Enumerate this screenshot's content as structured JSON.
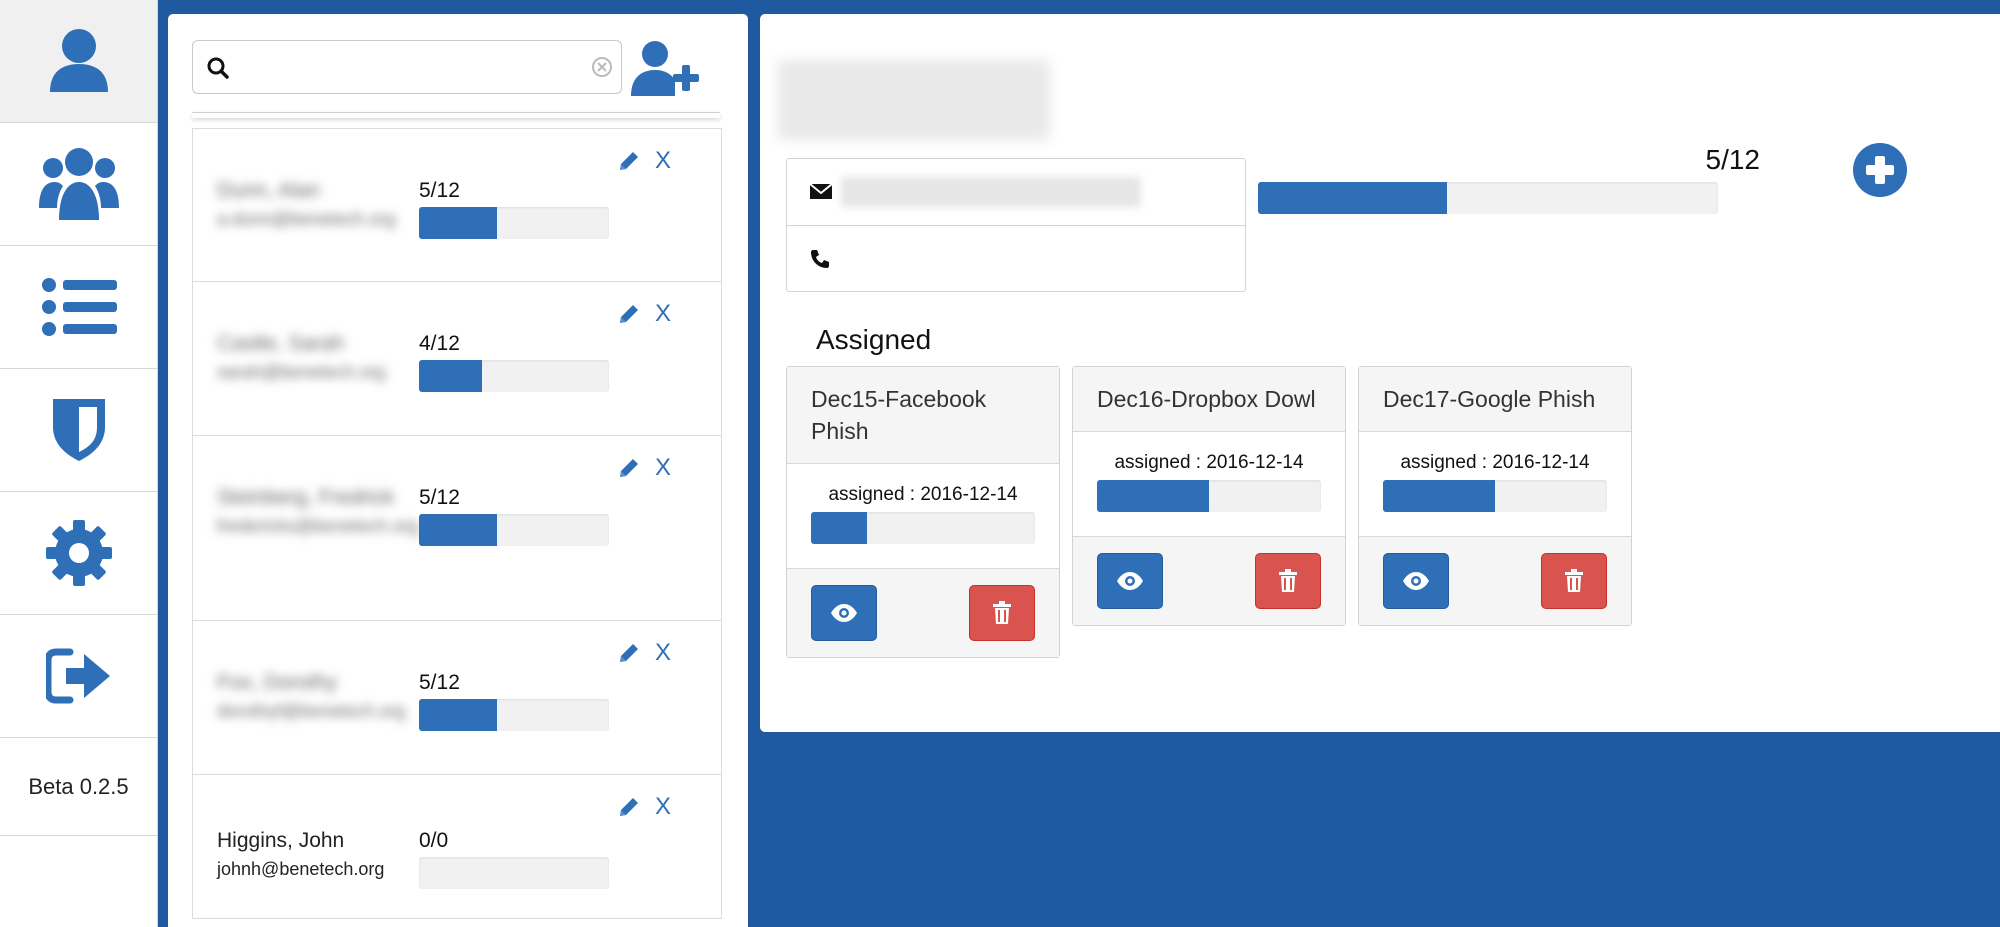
{
  "sidebar": {
    "items": [
      {
        "name": "user",
        "icon": "user-icon"
      },
      {
        "name": "users",
        "icon": "users-group-icon"
      },
      {
        "name": "list",
        "icon": "list-icon"
      },
      {
        "name": "shield",
        "icon": "shield-icon"
      },
      {
        "name": "settings",
        "icon": "gear-icon"
      },
      {
        "name": "logout",
        "icon": "sign-out-icon"
      }
    ],
    "version": "Beta 0.2.5"
  },
  "search": {
    "value": "",
    "placeholder": ""
  },
  "users": [
    {
      "name": "Dunn, Alan",
      "email": "a.dunn@benetech.org",
      "count": "5/12",
      "progress": 0.42
    },
    {
      "name": "Castle, Sarah",
      "email": "sarah@benetech.org",
      "count": "4/12",
      "progress": 0.33
    },
    {
      "name": "Steinberg, Fredrick",
      "email": "fredericks@benetech.org",
      "count": "5/12",
      "progress": 0.42
    },
    {
      "name": "Fox, Dorothy",
      "email": "dorothyf@benetech.org",
      "count": "5/12",
      "progress": 0.42
    },
    {
      "name": "Higgins, John",
      "email": "johnh@benetech.org",
      "count": "0/0",
      "progress": 0
    }
  ],
  "detail": {
    "count": "5/12",
    "progress": 0.41,
    "assigned_title": "Assigned",
    "campaigns": [
      {
        "title": "Dec15-Facebook Phish",
        "assigned": "assigned : 2016-12-14",
        "progress": 0.25
      },
      {
        "title": "Dec16-Dropbox Dowl",
        "assigned": "assigned : 2016-12-14",
        "progress": 0.5
      },
      {
        "title": "Dec17-Google Phish",
        "assigned": "assigned : 2016-12-14",
        "progress": 0.5
      }
    ]
  },
  "colors": {
    "primary": "#2e6fb7",
    "danger": "#d9534f",
    "background": "#1f5aa0"
  }
}
